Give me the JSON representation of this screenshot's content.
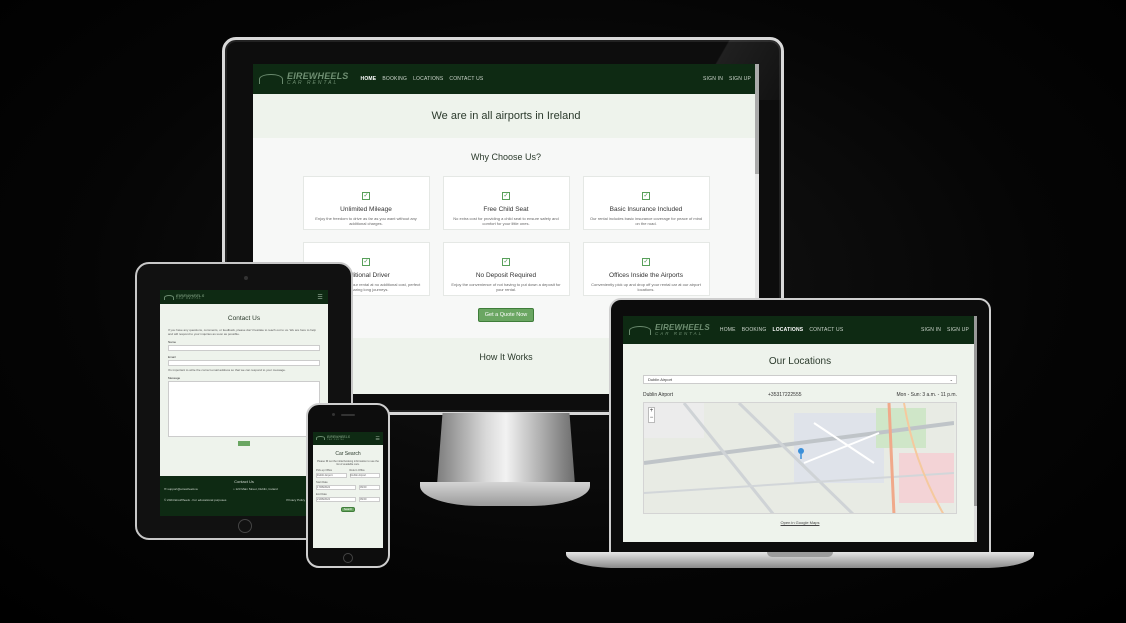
{
  "brand": {
    "name": "EIREWHEELS",
    "tagline": "CAR RENTAL"
  },
  "nav": {
    "items": [
      "HOME",
      "BOOKING",
      "LOCATIONS",
      "CONTACT US"
    ],
    "sign_in": "SIGN IN",
    "sign_up": "SIGN UP"
  },
  "monitor": {
    "hero": "We are in all airports in Ireland",
    "why_title": "Why Choose Us?",
    "features": [
      {
        "title": "Unlimited Mileage",
        "desc": "Enjoy the freedom to drive as far as you want without any additional charges."
      },
      {
        "title": "Free Child Seat",
        "desc": "No extra cost for providing a child seat to ensure safety and comfort for your little ones."
      },
      {
        "title": "Basic Insurance Included",
        "desc": "Our rental includes basic insurance coverage for peace of mind on the road."
      },
      {
        "title": "Additional Driver",
        "desc": "Add another driver to your rental at no additional cost, perfect for sharing long journeys."
      },
      {
        "title": "No Deposit Required",
        "desc": "Enjoy the convenience of not having to put down a deposit for your rental."
      },
      {
        "title": "Offices Inside the Airports",
        "desc": "Conveniently pick up and drop off your rental car at our airport locations."
      }
    ],
    "quote_button": "Get a Quote Now",
    "how_title": "How It Works"
  },
  "tablet": {
    "title": "Contact Us",
    "intro": "If you have any questions, comments, or feedback, please don't hesitate to reach out to us. We are here to help and will respond to your inquiries as soon as possible.",
    "name_label": "Name",
    "email_label": "Email",
    "email_note": "It's important to write the correct email address so that we can respond to your message.",
    "message_label": "Message",
    "footer_title": "Contact Us",
    "footer_email": "support@eirewheels.ie",
    "footer_address": "123 Main Street, Dublin, Ireland",
    "footer_phone": "+353",
    "copyright": "© 2024 EireWheels - For educational purposes",
    "privacy": "Privacy Policy",
    "terms": "Terms and..."
  },
  "phone": {
    "title": "Car Search",
    "intro": "Please fill out the initial booking information to see the list of available cars.",
    "pickup_label": "Pick-up Office",
    "return_label": "Return Office",
    "pickup_value": "Dublin Airport",
    "return_value": "Dublin Airport",
    "start_label": "Start Date",
    "end_label": "End Date",
    "start_date": "17/08/2024",
    "end_date": "21/08/2024",
    "start_time": "09:00",
    "end_time": "09:00",
    "search_button": "Search"
  },
  "laptop": {
    "title": "Our Locations",
    "selected_location": "Dublin Airport",
    "phone_number": "+35317222555",
    "hours": "Mon - Sun: 3 a.m. - 11 p.m.",
    "map_link": "Open in Google Maps"
  }
}
